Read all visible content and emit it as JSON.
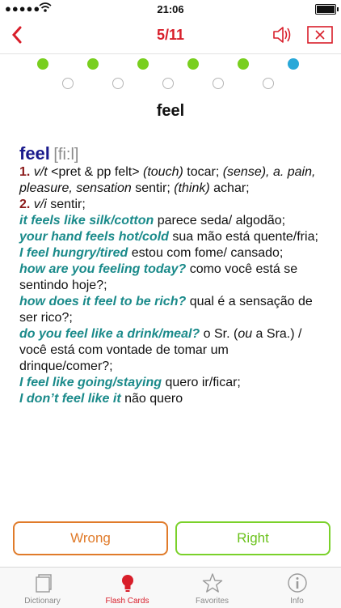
{
  "status": {
    "carrier": "●●●●●",
    "time": "21:06"
  },
  "nav": {
    "title": "5/11"
  },
  "card": {
    "word": "feel"
  },
  "entry": {
    "headword": "feel",
    "phonetic": "[fi:l]",
    "sense1": {
      "num": "1.",
      "pos": "v/t",
      "grammar": "<pret & pp felt>",
      "l1": "(touch)",
      "t1": " tocar; ",
      "l2": "(sense),",
      "l2b": "a. pain, pleasure, sensation",
      "t2": " sentir; ",
      "l3": "(think)",
      "t3": "achar;"
    },
    "sense2": {
      "num": "2.",
      "pos": "v/i",
      "trans": " sentir;"
    },
    "examples": [
      {
        "en": "it feels like silk/cotton",
        "pt": " parece seda/ algodão;"
      },
      {
        "en": "your hand feels hot/cold",
        "pt": " sua mão está quente/fria;"
      },
      {
        "en": "I feel hungry/tired",
        "pt": " estou com fome/ cansado;"
      },
      {
        "en": "how are you feeling today?",
        "pt": " como você está se sentindo hoje?;"
      },
      {
        "en": "how does it feel to be rich?",
        "pt": " qual é a sensação de ser rico?;"
      },
      {
        "en": "do you feel like a drink/meal?",
        "pt_pre": " o Sr. (",
        "pt_it": "ou",
        "pt_post": " a Sra.) / você está com vontade de tomar um drinque/comer?;"
      },
      {
        "en": "I feel like going/staying",
        "pt": " quero ir/ficar;"
      },
      {
        "en": "I don’t feel like it",
        "pt": " não quero"
      }
    ]
  },
  "buttons": {
    "wrong": "Wrong",
    "right": "Right"
  },
  "tabs": [
    {
      "label": "Dictionary",
      "icon": "dictionary-icon"
    },
    {
      "label": "Flash Cards",
      "icon": "lightbulb-icon"
    },
    {
      "label": "Favorites",
      "icon": "star-icon"
    },
    {
      "label": "Info",
      "icon": "info-icon"
    }
  ],
  "progress": {
    "total": 11,
    "current": 5,
    "completed": 5
  },
  "colors": {
    "accent": "#d81e2a",
    "green": "#79cf1f",
    "blue": "#29a8d8",
    "wrong": "#e07b2a",
    "example": "#1a8a8a"
  }
}
